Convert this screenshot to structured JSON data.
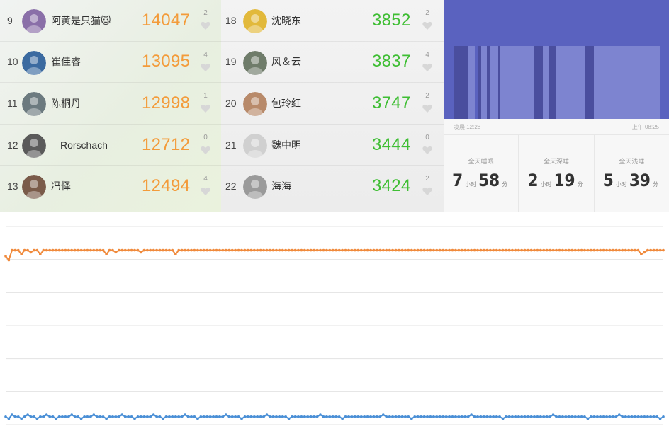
{
  "leaderboard_left": [
    {
      "rank": "9",
      "name": "阿黄是只猫🐱",
      "steps": "14047",
      "likes": "2"
    },
    {
      "rank": "10",
      "name": "崔佳睿",
      "steps": "13095",
      "likes": "4"
    },
    {
      "rank": "11",
      "name": "陈桐丹",
      "steps": "12998",
      "likes": "1"
    },
    {
      "rank": "12",
      "name": "Rorschach",
      "steps": "12712",
      "likes": "0"
    },
    {
      "rank": "13",
      "name": "冯怿",
      "steps": "12494",
      "likes": "4"
    }
  ],
  "leaderboard_mid": [
    {
      "rank": "18",
      "name": "沈晓东",
      "steps": "3852",
      "likes": "2"
    },
    {
      "rank": "19",
      "name": "风＆云",
      "steps": "3837",
      "likes": "4"
    },
    {
      "rank": "20",
      "name": "包玲红",
      "steps": "3747",
      "likes": "2"
    },
    {
      "rank": "21",
      "name": "魏中明",
      "steps": "3444",
      "likes": "0"
    },
    {
      "rank": "22",
      "name": "海海",
      "steps": "3424",
      "likes": "2"
    }
  ],
  "sleep": {
    "start_time": "凌晨 12:28",
    "end_time": "上午 08:25",
    "stats": [
      {
        "label": "全天睡眠",
        "hours": "7",
        "hour_unit": "小时",
        "minutes": "58",
        "minute_unit": "分"
      },
      {
        "label": "全天深睡",
        "hours": "2",
        "hour_unit": "小时",
        "minutes": "19",
        "minute_unit": "分"
      },
      {
        "label": "全天浅睡",
        "hours": "5",
        "hour_unit": "小时",
        "minutes": "39",
        "minute_unit": "分"
      }
    ],
    "stage_sequence": [
      "deep",
      "light",
      "deep",
      "light",
      "deep",
      "light",
      "deep",
      "light",
      "deep",
      "light",
      "deep",
      "light",
      "deep",
      "light"
    ],
    "colors": {
      "awake": "#5a62bf",
      "deep": "#4a4e9e",
      "light": "#7d84d0"
    }
  },
  "chart_data": {
    "type": "line",
    "ylim": [
      0,
      100
    ],
    "grid": true,
    "series": [
      {
        "color": "#f08a3c",
        "values": [
          85,
          83,
          88,
          88,
          88,
          86,
          88,
          88,
          87,
          88,
          88,
          86,
          88,
          88,
          88,
          88,
          88,
          88,
          88,
          88,
          88,
          88,
          88,
          88,
          88,
          88,
          88,
          88,
          88,
          88,
          88,
          88,
          86,
          88,
          88,
          87,
          88,
          88,
          88,
          88,
          88,
          88,
          88,
          87,
          88,
          88,
          88,
          88,
          88,
          88,
          88,
          88,
          88,
          88,
          86,
          88,
          88,
          88,
          88,
          88,
          88,
          88,
          88,
          88,
          88,
          88,
          88,
          88,
          88,
          88,
          88,
          88,
          88,
          88,
          88,
          88,
          88,
          88,
          88,
          88,
          88,
          88,
          88,
          88,
          88,
          88,
          88,
          88,
          88,
          88,
          88,
          88,
          88,
          88,
          88,
          88,
          88,
          88,
          88,
          88,
          88,
          88,
          88,
          88,
          88,
          88,
          88,
          88,
          88,
          88,
          88,
          88,
          88,
          88,
          88,
          88,
          88,
          88,
          88,
          88,
          88,
          88,
          88,
          88,
          88,
          88,
          88,
          88,
          88,
          88,
          88,
          88,
          88,
          88,
          88,
          88,
          88,
          88,
          88,
          88,
          88,
          88,
          88,
          88,
          88,
          88,
          88,
          88,
          88,
          88,
          88,
          88,
          88,
          88,
          88,
          88,
          88,
          88,
          88,
          88,
          88,
          88,
          88,
          88,
          88,
          88,
          88,
          88,
          88,
          88,
          88,
          88,
          88,
          88,
          88,
          88,
          88,
          88,
          88,
          88,
          88,
          88,
          88,
          88,
          88,
          88,
          88,
          88,
          88,
          88,
          88,
          88,
          88,
          88,
          88,
          88,
          88,
          88,
          88,
          88,
          88,
          88,
          86,
          87,
          88,
          88,
          88,
          88,
          88,
          88
        ]
      },
      {
        "color": "#4a8fd6",
        "values": [
          4,
          3,
          5,
          4,
          4,
          3,
          4,
          5,
          4,
          4,
          3,
          4,
          4,
          5,
          4,
          4,
          3,
          4,
          4,
          4,
          4,
          5,
          4,
          4,
          3,
          4,
          4,
          4,
          5,
          4,
          4,
          4,
          3,
          4,
          4,
          4,
          4,
          5,
          4,
          4,
          4,
          3,
          4,
          4,
          4,
          4,
          4,
          5,
          4,
          4,
          3,
          4,
          4,
          4,
          4,
          4,
          4,
          5,
          4,
          4,
          4,
          3,
          4,
          4,
          4,
          4,
          4,
          4,
          4,
          4,
          5,
          4,
          4,
          4,
          4,
          3,
          4,
          4,
          4,
          4,
          4,
          4,
          4,
          5,
          4,
          4,
          4,
          4,
          4,
          4,
          3,
          4,
          4,
          4,
          4,
          4,
          4,
          4,
          4,
          4,
          5,
          4,
          4,
          4,
          4,
          4,
          4,
          3,
          4,
          4,
          4,
          4,
          4,
          4,
          4,
          4,
          4,
          4,
          4,
          4,
          5,
          4,
          4,
          4,
          4,
          4,
          4,
          4,
          4,
          3,
          4,
          4,
          4,
          4,
          4,
          4,
          4,
          4,
          4,
          4,
          4,
          4,
          4,
          4,
          4,
          4,
          4,
          4,
          5,
          4,
          4,
          4,
          4,
          4,
          4,
          4,
          4,
          4,
          3,
          4,
          4,
          4,
          4,
          4,
          4,
          4,
          4,
          4,
          4,
          4,
          4,
          4,
          4,
          4,
          5,
          4,
          4,
          4,
          4,
          4,
          4,
          4,
          4,
          4,
          4,
          3,
          4,
          4,
          4,
          4,
          4,
          4,
          4,
          4,
          4,
          5,
          4,
          4,
          4,
          4,
          4,
          4,
          4,
          4,
          4,
          4,
          4,
          4,
          3,
          4
        ]
      }
    ]
  }
}
